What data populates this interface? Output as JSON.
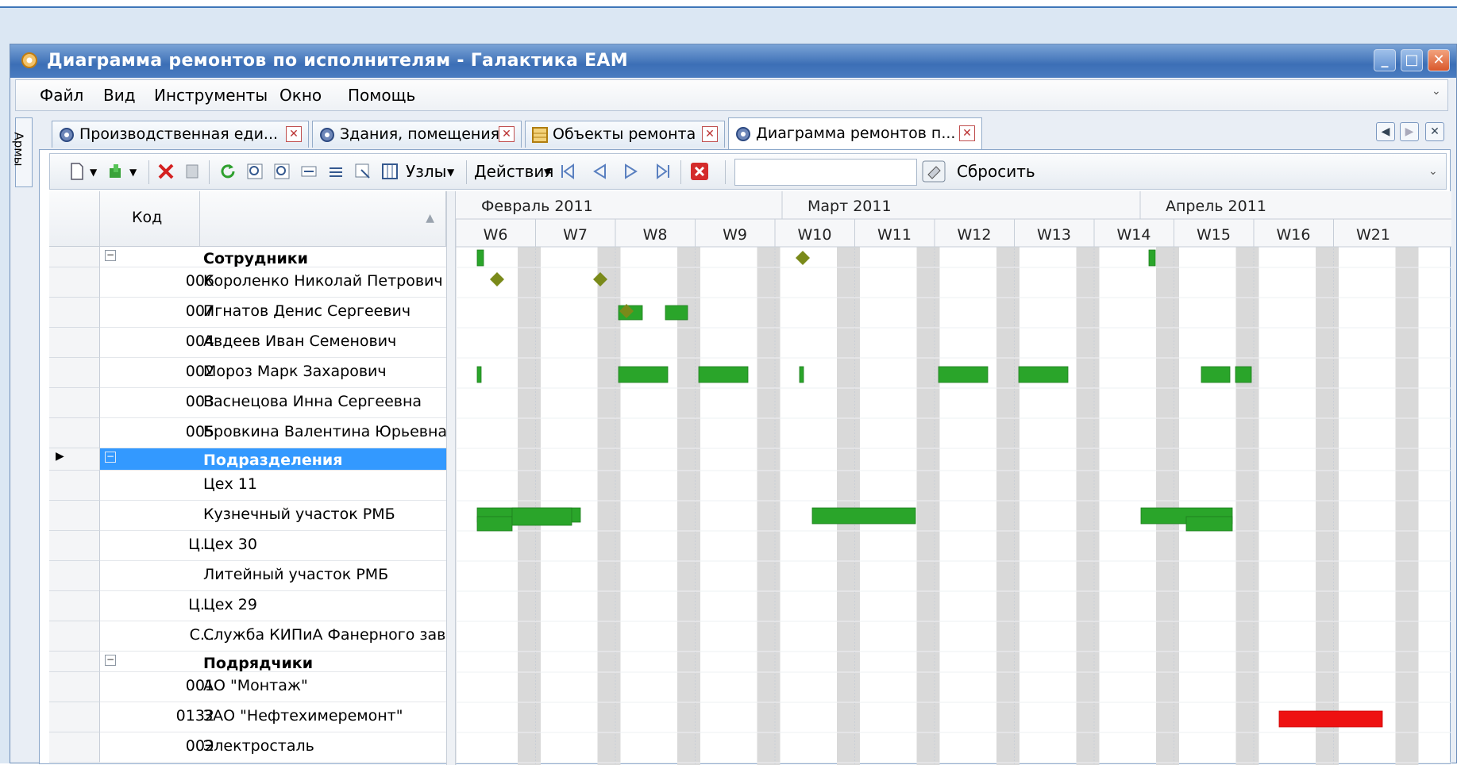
{
  "window": {
    "title": "Диаграмма ремонтов по исполнителям - Галактика EAM",
    "minimize": "_",
    "maximize": "□",
    "close": "✕"
  },
  "menu": [
    "Файл",
    "Вид",
    "Инструменты",
    "Окно",
    "Помощь"
  ],
  "side_tab": "Армы",
  "tabs": [
    {
      "label": "Производственная еди...",
      "icon": "gear-icon",
      "active": false
    },
    {
      "label": "Здания, помещения",
      "icon": "gear-icon",
      "active": false
    },
    {
      "label": "Объекты ремонта",
      "icon": "table-icon",
      "active": false
    },
    {
      "label": "Диаграмма ремонтов п...",
      "icon": "gear-icon",
      "active": true
    }
  ],
  "toolbar": {
    "nodes_label": "Узлы",
    "actions_label": "Действия",
    "filter_value": "",
    "reset_label": "Сбросить"
  },
  "grid": {
    "code_header": "Код",
    "rows": [
      {
        "code": "",
        "name": "Сотрудники",
        "group": true,
        "expander": "−"
      },
      {
        "code": "006",
        "name": "Короленко Николай Петрович"
      },
      {
        "code": "007",
        "name": "Игнатов Денис Сергеевич"
      },
      {
        "code": "004",
        "name": "Авдеев Иван Семенович"
      },
      {
        "code": "002",
        "name": "Мороз Марк Захарович"
      },
      {
        "code": "003",
        "name": "Васнецова Инна Сергеевна"
      },
      {
        "code": "005",
        "name": "Бровкина Валентина Юрьевна"
      },
      {
        "code": "",
        "name": "Подразделения",
        "group": true,
        "selected": true,
        "expander": "−"
      },
      {
        "code": "",
        "name": "Цех 11"
      },
      {
        "code": "",
        "name": "Кузнечный участок РМБ"
      },
      {
        "code": "Ц...",
        "name": "Цех 30"
      },
      {
        "code": "",
        "name": "Литейный участок РМБ"
      },
      {
        "code": "Ц...",
        "name": "Цех 29"
      },
      {
        "code": "С...",
        "name": "Служба КИПиА Фанерного завода"
      },
      {
        "code": "",
        "name": "Подрядчики",
        "group": true,
        "expander": "−"
      },
      {
        "code": "001",
        "name": "АО \"Монтаж\""
      },
      {
        "code": "0132",
        "name": "ЗАО \"Нефтехимеремонт\""
      },
      {
        "code": "002",
        "name": "Электросталь"
      }
    ]
  },
  "gantt": {
    "months": [
      "Февраль 2011",
      "Март 2011",
      "Апрель 2011"
    ],
    "weeks": [
      "W6",
      "W7",
      "W8",
      "W9",
      "W10",
      "W11",
      "W12",
      "W13",
      "W14",
      "W15",
      "W16",
      "W21"
    ],
    "colors": {
      "task": "#2aa52a",
      "milestone": "#7a8a1a",
      "overdue": "#ee1111",
      "weekend": "#d9d9d9"
    }
  }
}
